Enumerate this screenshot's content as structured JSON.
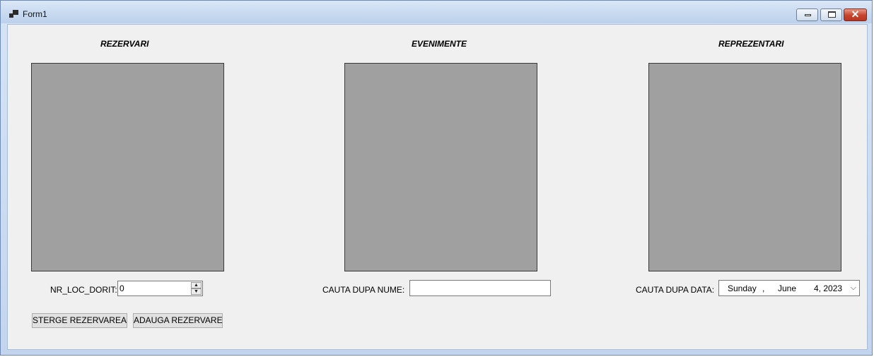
{
  "window": {
    "title": "Form1"
  },
  "panels": {
    "rezervari": {
      "heading": "REZERVARI"
    },
    "evenimente": {
      "heading": "EVENIMENTE"
    },
    "reprezentari": {
      "heading": "REPREZENTARI"
    }
  },
  "rezervari_controls": {
    "nr_loc_label": "NR_LOC_DORIT:",
    "nr_loc_value": "0",
    "delete_button": "STERGE REZERVAREA",
    "add_button": "ADAUGA REZERVARE"
  },
  "evenimente_controls": {
    "search_label": "CAUTA DUPA NUME:",
    "search_value": ""
  },
  "reprezentari_controls": {
    "date_label": "CAUTA DUPA DATA:",
    "date_weekday": "Sunday",
    "date_sep": ",",
    "date_month": "June",
    "date_day_year": "4, 2023"
  },
  "icons": {
    "app": "app-form-icon",
    "minimize": "minimize-icon",
    "maximize": "maximize-icon",
    "close": "close-icon",
    "dropdown": "chevron-down-icon"
  },
  "colors": {
    "grid_background": "#a0a0a0",
    "client_background": "#f0f0f0",
    "close_button": "#c6432c"
  }
}
